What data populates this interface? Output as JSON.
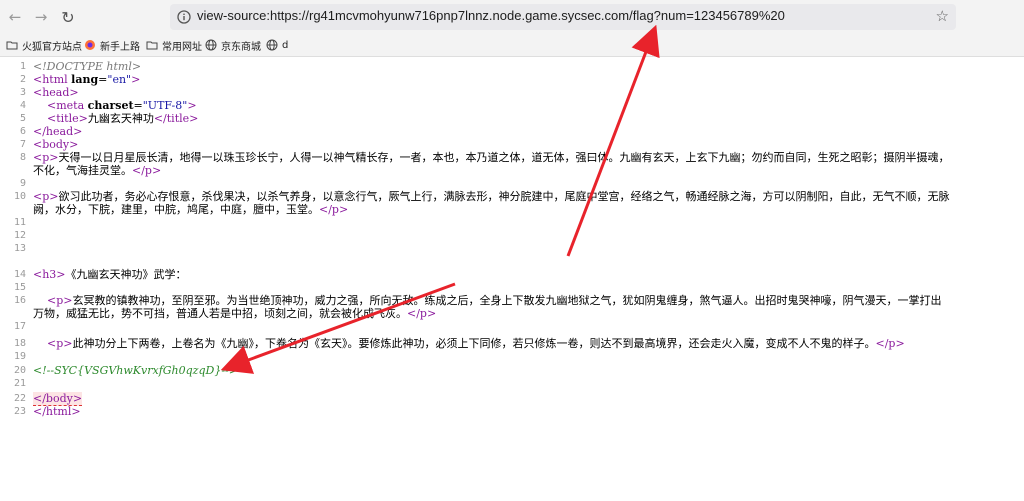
{
  "browser": {
    "back_icon": "arrow-left-icon",
    "forward_icon": "arrow-right-icon",
    "reload_icon": "reload-icon",
    "url": "view-source:https://rg41mcvmohyunw716pnp7lnnz.node.game.sycsec.com/flag?num=123456789%20",
    "star_icon": "star-icon"
  },
  "bookmarks": [
    {
      "label": "火狐官方站点",
      "icon": "folder-icon"
    },
    {
      "label": "新手上路",
      "icon": "firefox-icon"
    },
    {
      "label": "常用网址",
      "icon": "folder-icon"
    },
    {
      "label": "京东商城",
      "icon": "globe-icon"
    },
    {
      "label": "d",
      "icon": "globe-icon"
    }
  ],
  "source": {
    "line_numbers": [
      "1",
      "2",
      "3",
      "4",
      "5",
      "6",
      "7",
      "8",
      "9",
      "10",
      "11",
      "12",
      "13",
      "14",
      "15",
      "16",
      "17",
      "18",
      "19",
      "20",
      "21",
      "22",
      "23"
    ],
    "doctype": "<!DOCTYPE html>",
    "html_open": "<html",
    "lang_attr": "lang",
    "lang_val": "\"en\"",
    "head_open": "<head>",
    "meta_open": "<meta",
    "charset_attr": "charset",
    "charset_val": "\"UTF-8\"",
    "title_open": "<title>",
    "title_text": "九幽玄天神功",
    "title_close": "</title>",
    "head_close": "</head>",
    "body_open": "<body>",
    "p_open": "<p>",
    "p_close": "</p>",
    "p1_a": "天得一以日月星辰长清，地得一以珠玉珍长宁，人得一以神气精长存，一者，本也，本乃道之体，道无体，强曰体。九幽有玄天，上玄下九幽；勿约而自同，生死之昭彰；摄阴半摄魂，",
    "p1_b": "不化，气海挂灵堂。",
    "p2_a": "欲习此功者，务必心存恨意，杀伐果决，以杀气养身，以意念行气，厥气上行，满脉去形，神分脘建中，尾庭中堂宫，经络之气，畅通经脉之海，方可以阴制阳，自此，无气不顺，无脉",
    "p2_b": "阙，水分，下脘，建里，中脘，鸠尾，中庭，膻中，玉堂。",
    "h3_open": "<h3>",
    "h3_text": "《九幽玄天神功》武学：",
    "p3_a": "玄冥教的镇教神功，至阴至邪。为当世绝顶神功，威力之强，所向无敌。练成之后，全身上下散发九幽地狱之气，犹如阴鬼缠身，煞气逼人。出招时鬼哭神嚎，阴气漫天，一掌打出",
    "p3_b": "万物，威猛无比，势不可挡，普通人若是中招，顷刻之间，就会被化成飞灰。",
    "p4": "此神功分上下两卷，上卷名为《九幽》，下卷名为《玄天》。要修炼此神功，必须上下同修，若只修炼一卷，则达不到最高境界，还会走火入魔，变成不人不鬼的样子。",
    "comment": "<!--SYC{VSGVhwKvrxfGh0qzqD}-->",
    "body_close": "</body>",
    "html_close": "</html>"
  }
}
